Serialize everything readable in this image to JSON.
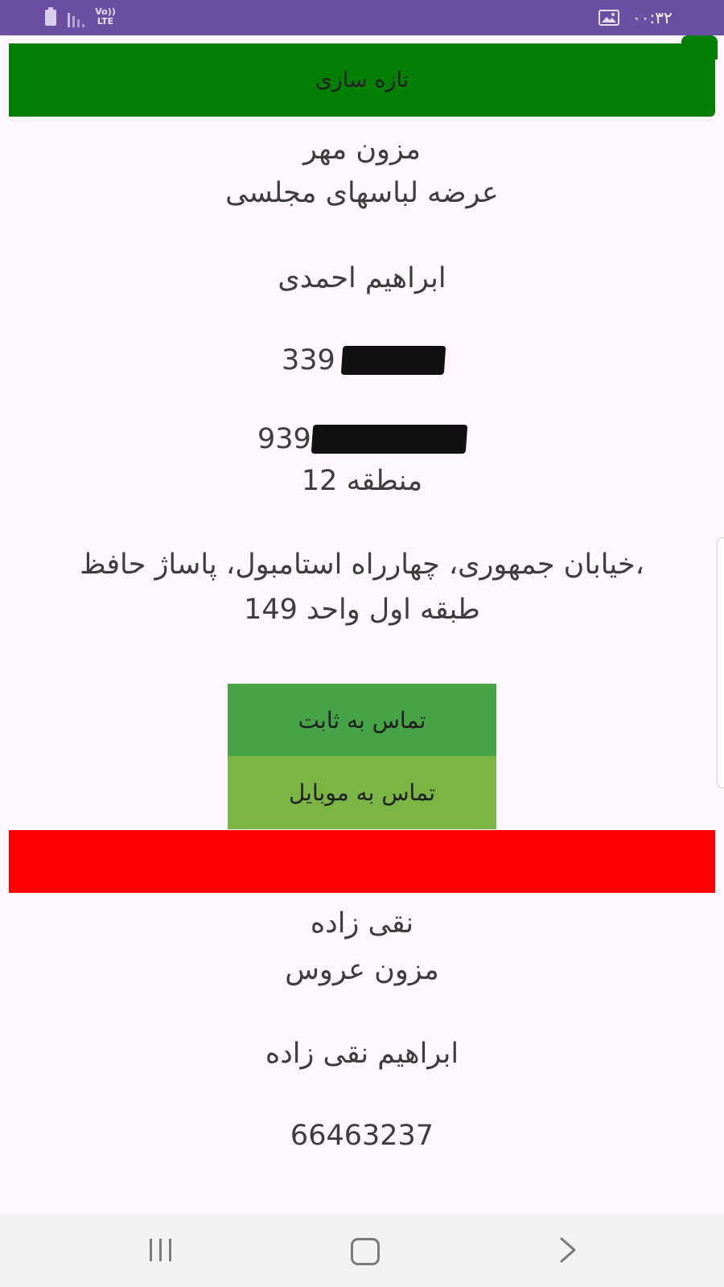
{
  "status_bar": {
    "network": "LTE",
    "time": "۰۰:۳۲"
  },
  "toolbar": {
    "refresh_label": "تازه سازی"
  },
  "shop1": {
    "name": "مزون مهر",
    "description": "عرضه لباسهای مجلسی",
    "owner": "ابراهیم احمدی",
    "landline": "339",
    "mobile": "939",
    "region": "منطقه 12",
    "address_line1": "خیابان جمهوری، چهارراه استامبول، پاساژ حافظ،",
    "address_line2": "طبقه اول واحد 149",
    "call_landline_label": "تماس به ثابت",
    "call_mobile_label": "تماس به موبایل"
  },
  "shop2": {
    "name": "نقی زاده",
    "description": "مزون عروس",
    "owner": "ابراهیم نقی زاده",
    "landline": "66463237"
  },
  "colors": {
    "status_bar": "#6a4fa3",
    "refresh_button": "#037f04",
    "call_landline_button": "#46a346",
    "call_mobile_button": "#7bb544",
    "separator": "#ff0000",
    "background": "#fdf7fd"
  },
  "icons": {
    "battery": "battery-icon",
    "signal": "signal-icon",
    "gallery": "image-icon",
    "nav_recents": "recents-icon",
    "nav_home": "home-icon",
    "nav_back": "back-icon"
  }
}
